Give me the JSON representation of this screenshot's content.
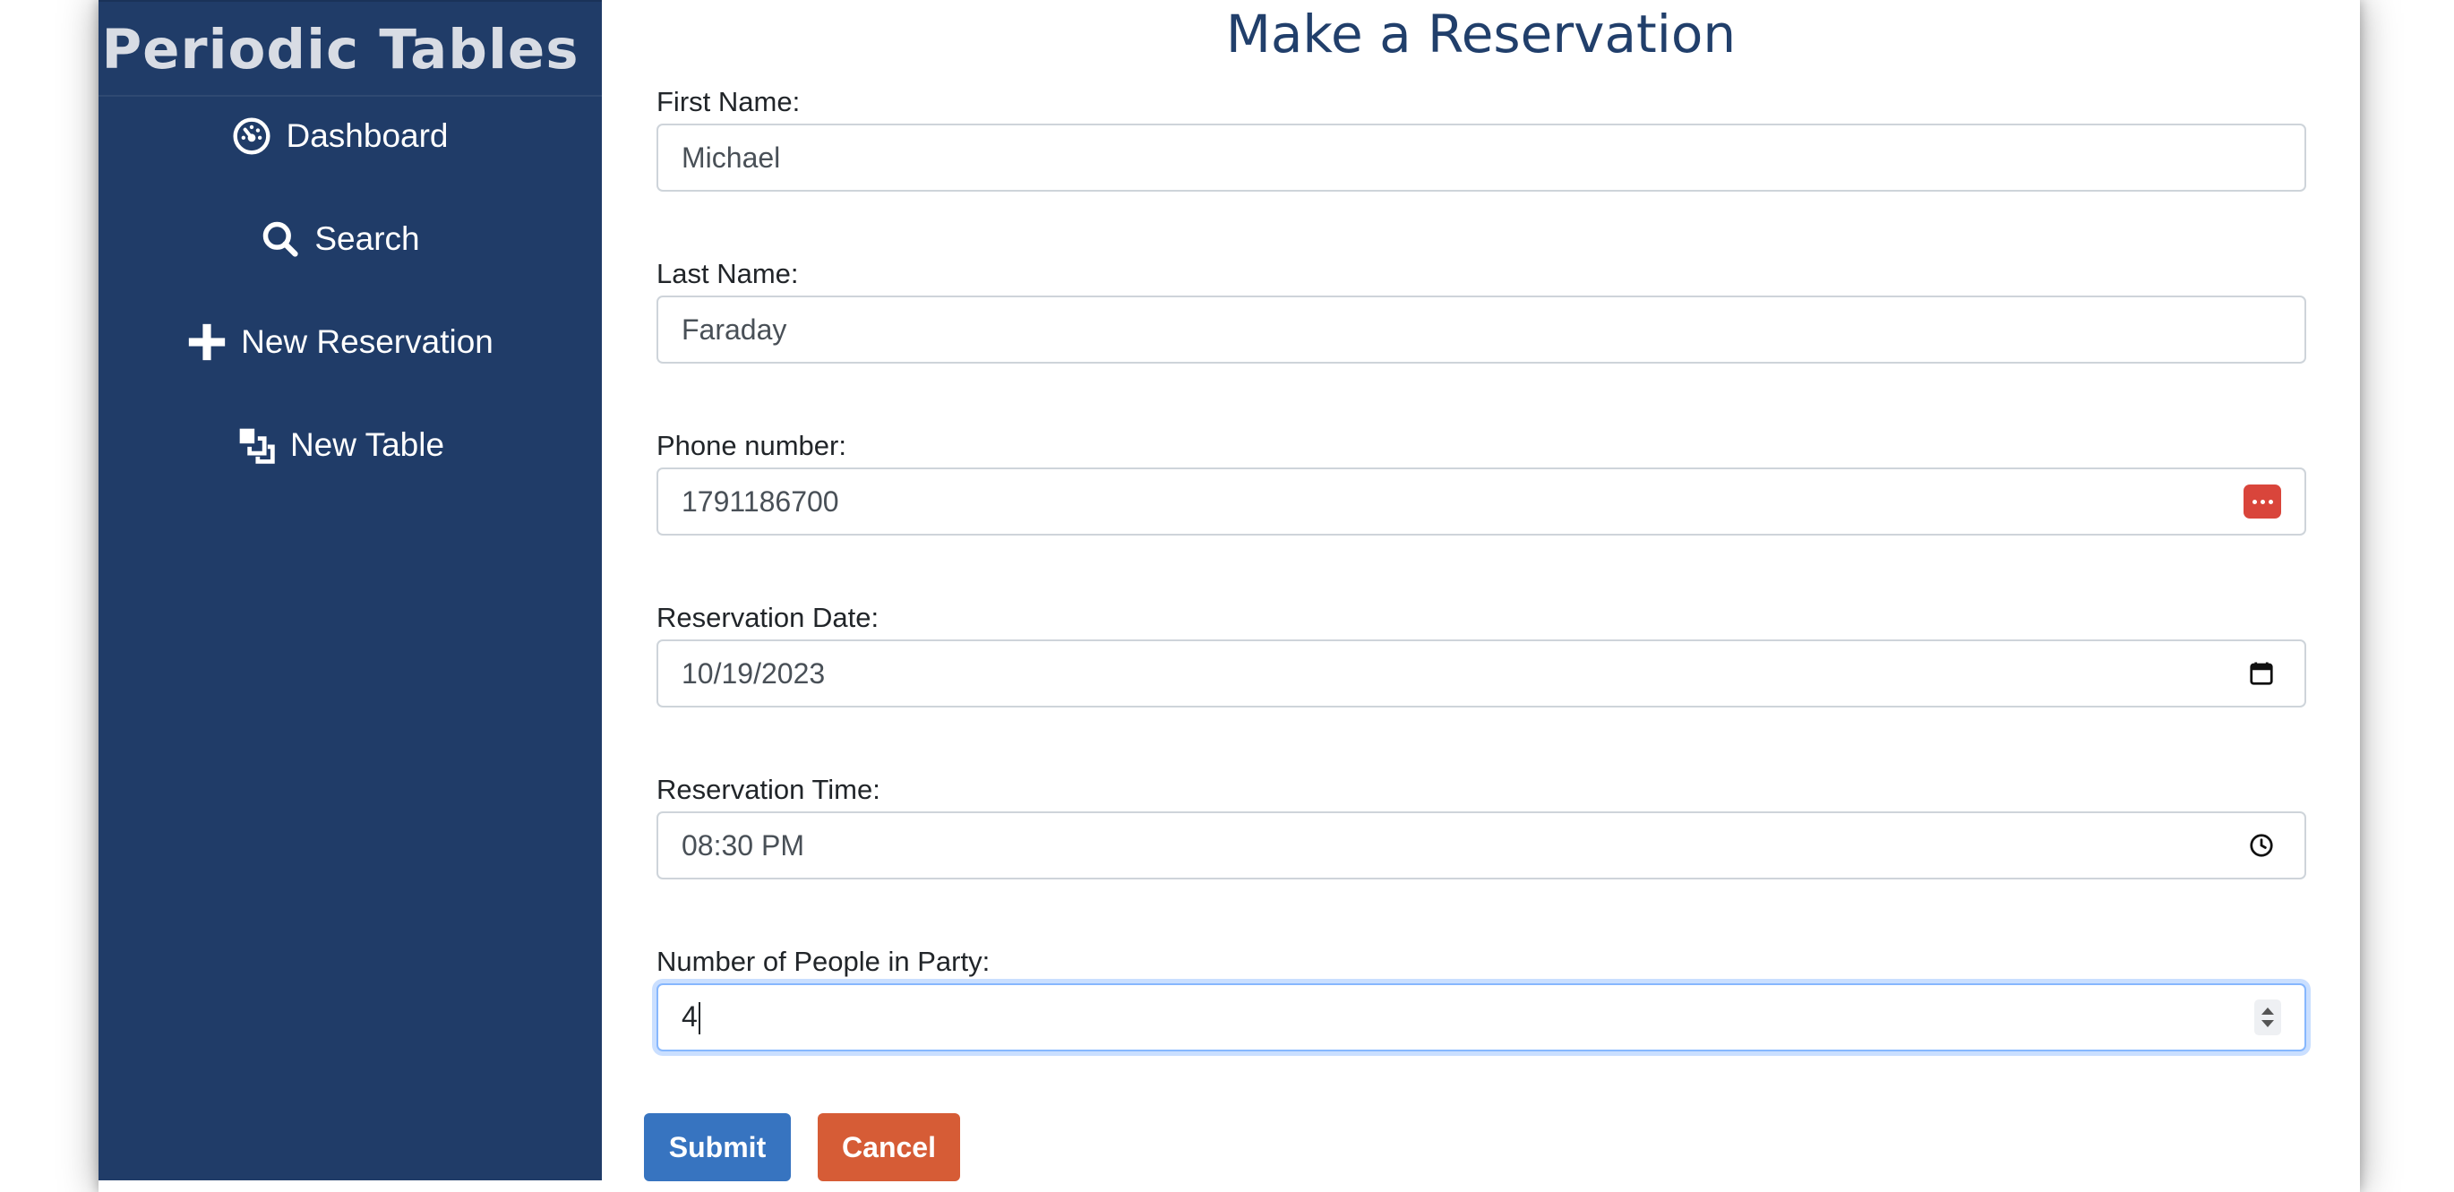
{
  "sidebar": {
    "brand": "Periodic Tables",
    "items": [
      {
        "label": "Dashboard",
        "icon": "dashboard-icon"
      },
      {
        "label": "Search",
        "icon": "search-icon"
      },
      {
        "label": "New Reservation",
        "icon": "plus-icon"
      },
      {
        "label": "New Table",
        "icon": "layers-icon"
      }
    ]
  },
  "form": {
    "title": "Make a Reservation",
    "first_name": {
      "label": "First Name:",
      "value": "Michael"
    },
    "last_name": {
      "label": "Last Name:",
      "value": "Faraday"
    },
    "phone": {
      "label": "Phone number:",
      "value": "1791186700"
    },
    "date": {
      "label": "Reservation Date:",
      "value": "10/19/2023"
    },
    "time": {
      "label": "Reservation Time:",
      "value": "08:30 PM"
    },
    "people": {
      "label": "Number of People in Party:",
      "value": "4"
    },
    "submit_label": "Submit",
    "cancel_label": "Cancel"
  },
  "colors": {
    "sidebar_bg": "#203c68",
    "title": "#213f6b",
    "submit": "#3774c0",
    "cancel": "#d65c36",
    "password_badge": "#d9453b"
  }
}
